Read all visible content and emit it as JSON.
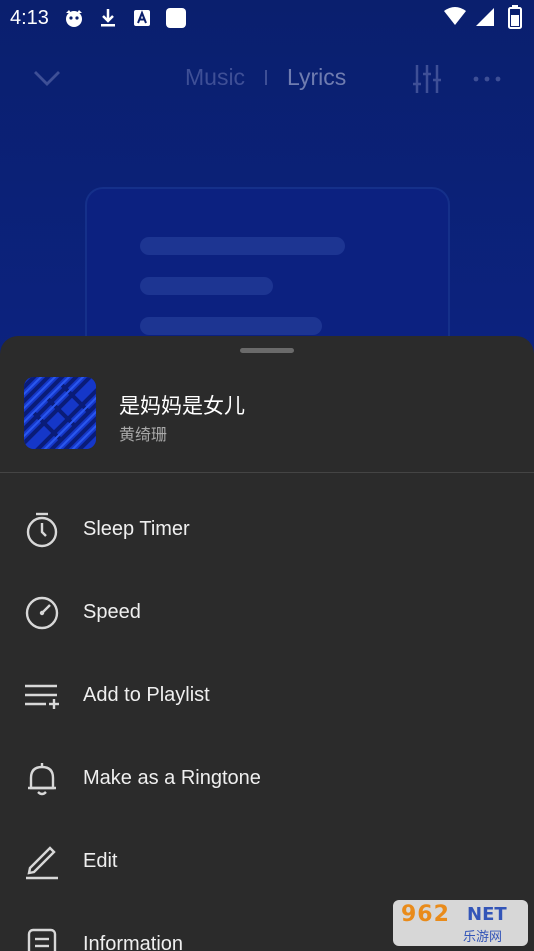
{
  "status_bar": {
    "time": "4:13",
    "left_icons": [
      "pet-icon",
      "download-icon",
      "font-app-icon",
      "app-square-icon"
    ],
    "right_icons": [
      "wifi-icon",
      "signal-icon",
      "battery-icon"
    ]
  },
  "nav": {
    "tab_music": "Music",
    "tab_lyrics": "Lyrics",
    "active_tab": "Lyrics",
    "icons": [
      "chevron-down-icon",
      "equalizer-icon",
      "more-icon"
    ]
  },
  "sheet": {
    "song": {
      "title": "是妈妈是女儿",
      "artist": "黄绮珊"
    },
    "menu": [
      {
        "label": "Sleep Timer",
        "icon": "timer-icon"
      },
      {
        "label": "Speed",
        "icon": "speed-icon"
      },
      {
        "label": "Add to Playlist",
        "icon": "add-playlist-icon"
      },
      {
        "label": "Make as a Ringtone",
        "icon": "bell-icon"
      },
      {
        "label": "Edit",
        "icon": "edit-icon"
      },
      {
        "label": "Information",
        "icon": "information-icon"
      }
    ]
  },
  "watermark": {
    "main": "962",
    "net": "NET",
    "sub": "乐游网"
  },
  "colors": {
    "background": "#0b1f6b",
    "sheet": "#2b2b2b",
    "cover": "#1537c8"
  }
}
